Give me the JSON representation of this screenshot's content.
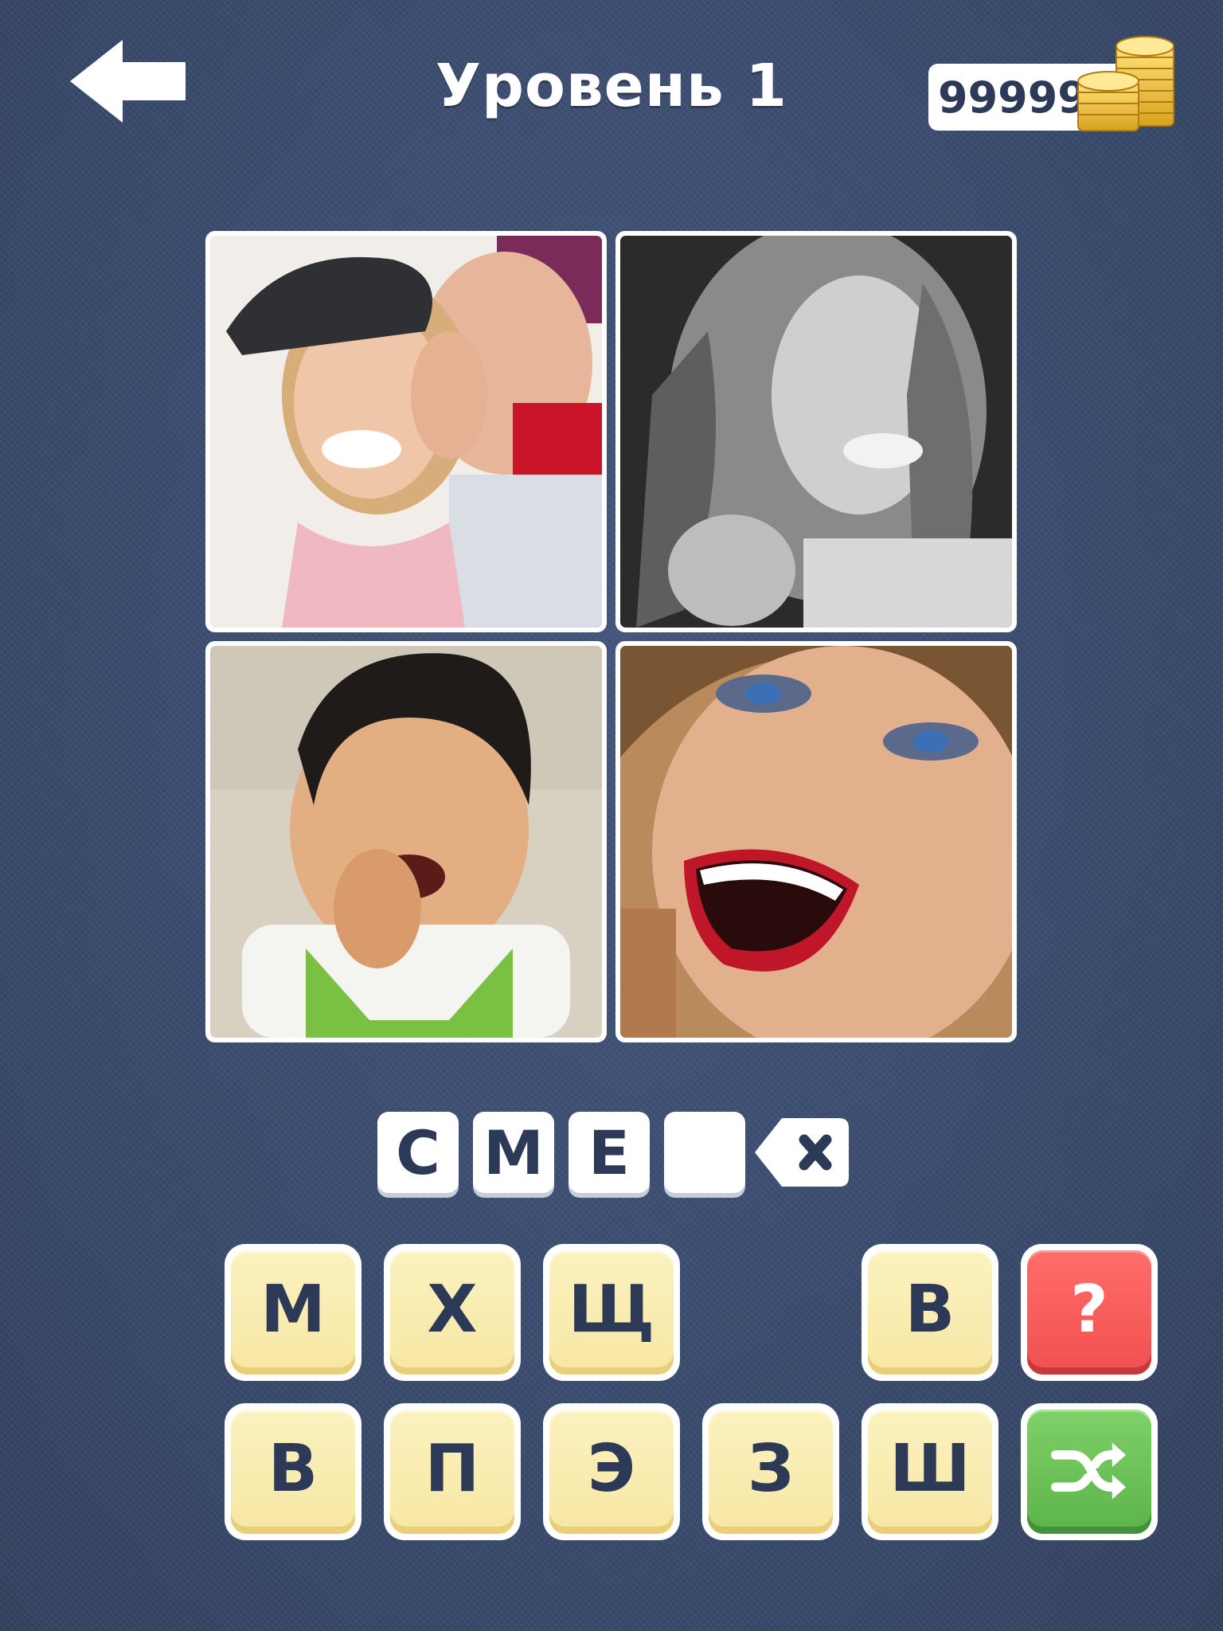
{
  "header": {
    "title": "Уровень 1",
    "coins": "99999"
  },
  "answer": {
    "slots": [
      "С",
      "М",
      "Е",
      ""
    ]
  },
  "keyboard": {
    "row1": [
      "М",
      "Х",
      "Щ",
      "",
      "В"
    ],
    "row2": [
      "В",
      "П",
      "Э",
      "З",
      "Ш"
    ],
    "hint_label": "?",
    "shuffle_icon": "shuffle-icon"
  },
  "colors": {
    "background": "#3b4d70",
    "key_yellow": "#f7e7a3",
    "hint_red": "#f04f4f",
    "shuffle_green": "#5bb44a",
    "text_dark": "#2c3a57"
  }
}
